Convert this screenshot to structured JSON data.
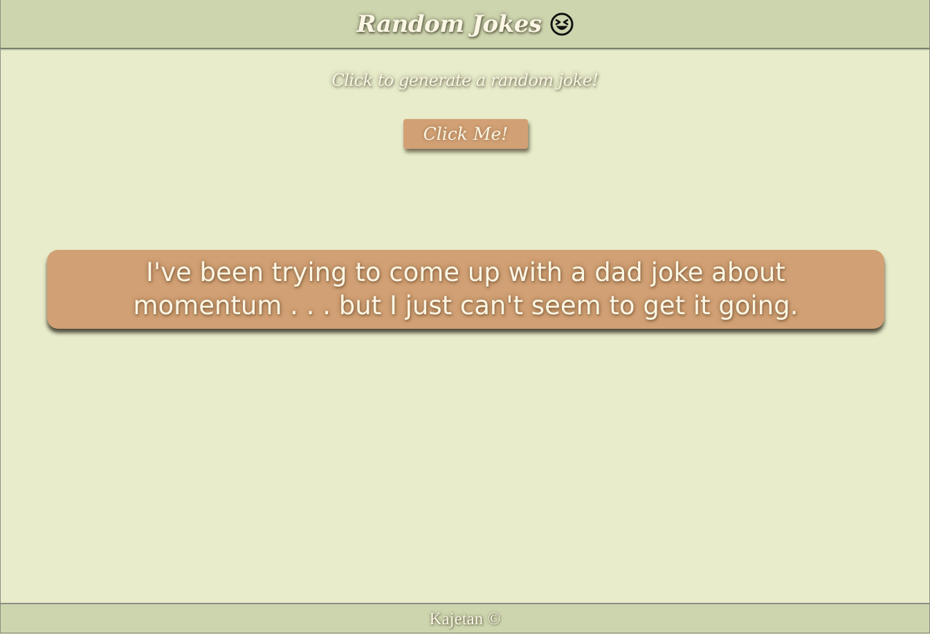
{
  "header": {
    "title": "Random Jokes",
    "emoji_icon": "grinning-squinting-face-icon"
  },
  "main": {
    "prompt": "Click to generate a random joke!",
    "button_label": "Click Me!",
    "joke": "I've been trying to come up with a dad joke about momentum . . . but I just can't seem to get it going."
  },
  "footer": {
    "text": "Kajetan ©"
  },
  "colors": {
    "background": "#e8ecca",
    "header_footer": "#cdd5ae",
    "accent": "#d1a074",
    "text_light": "#fbf6e4"
  }
}
